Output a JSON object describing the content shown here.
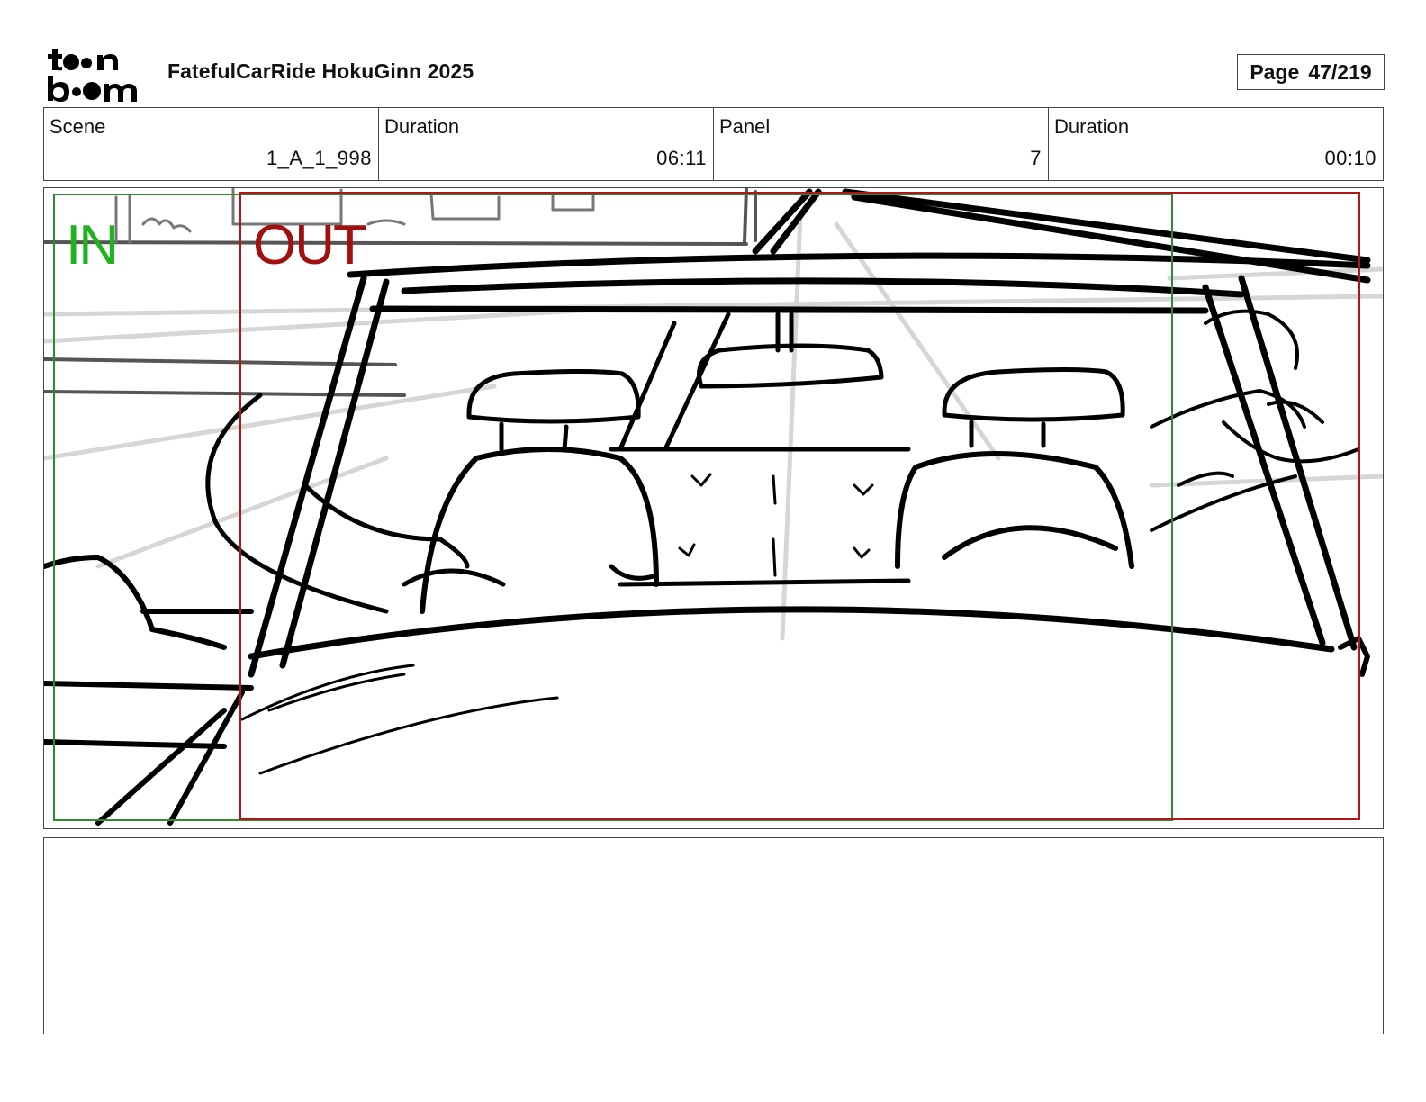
{
  "header": {
    "logo_icon": "toonboom-logo",
    "project_title": "FatefulCarRide HokuGinn 2025",
    "page_label": "Page",
    "page_number": "47/219"
  },
  "info": {
    "scene_label": "Scene",
    "scene_value": "1_A_1_998",
    "scene_duration_label": "Duration",
    "scene_duration_value": "06:11",
    "panel_label": "Panel",
    "panel_value": "7",
    "panel_duration_label": "Duration",
    "panel_duration_value": "00:10"
  },
  "panel": {
    "image_icon": "storyboard-sketch",
    "in_label": "IN",
    "out_label": "OUT",
    "in_color": "#1fb31f",
    "out_color": "#a10f0f"
  },
  "notes": {
    "text": ""
  }
}
